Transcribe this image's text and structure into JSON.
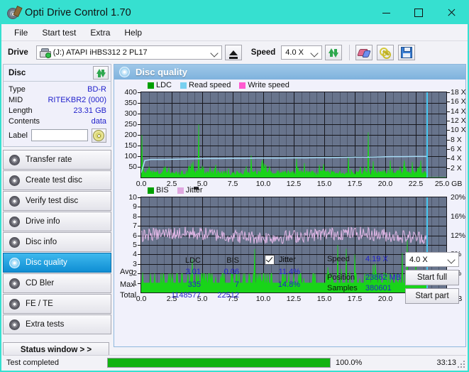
{
  "window": {
    "title": "Opti Drive Control 1.70",
    "icon": "disc-pen-icon",
    "minimize": "minimize",
    "maximize": "maximize",
    "close": "close",
    "titlebar_color": "#36e0d0"
  },
  "menubar": {
    "items": [
      {
        "label": "File"
      },
      {
        "label": "Start test"
      },
      {
        "label": "Extra"
      },
      {
        "label": "Help"
      }
    ]
  },
  "toolbar": {
    "drive_label": "Drive",
    "drive_value": "(J:)   ATAPI iHBS312   2 PL17",
    "eject_title": "eject",
    "speed_label": "Speed",
    "speed_value": "4.0 X",
    "refresh_title": "refresh",
    "erase_title": "erase",
    "tools_title": "tools",
    "save_title": "save"
  },
  "disc_panel": {
    "title": "Disc",
    "refresh_title": "refresh-disc",
    "rows": [
      {
        "key": "Type",
        "value": "BD-R"
      },
      {
        "key": "MID",
        "value": "RITEKBR2 (000)"
      },
      {
        "key": "Length",
        "value": "23.31 GB"
      },
      {
        "key": "Contents",
        "value": "data"
      }
    ],
    "label_key": "Label",
    "label_value": "",
    "label_placeholder": "",
    "cd_button_title": "disc-label"
  },
  "nav": {
    "items": [
      {
        "label": "Transfer rate",
        "active": false
      },
      {
        "label": "Create test disc",
        "active": false
      },
      {
        "label": "Verify test disc",
        "active": false
      },
      {
        "label": "Drive info",
        "active": false
      },
      {
        "label": "Disc info",
        "active": false
      },
      {
        "label": "Disc quality",
        "active": true
      },
      {
        "label": "CD Bler",
        "active": false
      },
      {
        "label": "FE / TE",
        "active": false
      },
      {
        "label": "Extra tests",
        "active": false
      }
    ],
    "status_window": "Status window > >"
  },
  "content": {
    "title": "Disc quality",
    "icon": "disc-quality-icon"
  },
  "chart_data": [
    {
      "type": "line",
      "name": "ldc-read-speed-chart",
      "title": "",
      "xlabel": "GB",
      "ylabel": "LDC",
      "xlim": [
        0,
        25.0
      ],
      "ylim": [
        0,
        400
      ],
      "y2lim": [
        0,
        18
      ],
      "y2label": "X",
      "grid": true,
      "legend_position": "top-left",
      "legend": [
        {
          "label": "LDC",
          "color": "#00a000"
        },
        {
          "label": "Read speed",
          "color": "#79d0f0"
        },
        {
          "label": "Write speed",
          "color": "#ff5ad0"
        }
      ],
      "xticks": [
        "0.0",
        "2.5",
        "5.0",
        "7.5",
        "10.0",
        "12.5",
        "15.0",
        "17.5",
        "20.0",
        "22.5",
        "25.0 GB"
      ],
      "yticks": [
        "400",
        "350",
        "300",
        "250",
        "200",
        "150",
        "100",
        "50"
      ],
      "y2ticks": [
        "18 X",
        "16 X",
        "14 X",
        "12 X",
        "10 X",
        "8 X",
        "6 X",
        "4 X",
        "2 X"
      ],
      "series": [
        {
          "name": "LDC",
          "color": "#00c000",
          "x": [
            0.05,
            0.15,
            0.3,
            0.5,
            0.7,
            0.9,
            1.1,
            1.3,
            1.5,
            1.7,
            1.9,
            2.1,
            2.3,
            2.5,
            2.7,
            2.9,
            3.1,
            3.3,
            3.5,
            3.7,
            3.9,
            4.1,
            4.25,
            4.4,
            4.55,
            4.7,
            4.85,
            5.0,
            5.15,
            5.3,
            5.45,
            5.6,
            5.8,
            6.0,
            6.2,
            6.4,
            6.6,
            6.8,
            7.0,
            7.2,
            7.4,
            7.6,
            7.8,
            8.0,
            8.2,
            8.4,
            8.6,
            8.8,
            9.0,
            9.2,
            9.4,
            9.6,
            9.8,
            10.0,
            10.2,
            10.4,
            10.6,
            10.8,
            11.0,
            11.2,
            11.4,
            11.6,
            11.8,
            12.0,
            12.2,
            12.4,
            12.6,
            12.8,
            13.0,
            13.2,
            13.4,
            13.6,
            13.8,
            14.0,
            14.2,
            14.4,
            14.6,
            14.8,
            15.0,
            15.2,
            15.4,
            15.6,
            15.8,
            16.0,
            16.2,
            16.4,
            16.6,
            16.8,
            17.0,
            17.2,
            17.4,
            17.6,
            17.8,
            18.0,
            18.2,
            18.4,
            18.6,
            18.8,
            19.0,
            19.2,
            19.4,
            19.6,
            19.8,
            20.0,
            20.2,
            20.4,
            20.6,
            20.8,
            21.0,
            21.2,
            21.4,
            21.6,
            21.8,
            22.0,
            22.2,
            22.4,
            22.6,
            22.8,
            23.0,
            23.2,
            23.4
          ],
          "values": [
            260,
            30,
            25,
            20,
            40,
            22,
            18,
            30,
            20,
            25,
            35,
            20,
            18,
            25,
            30,
            20,
            25,
            18,
            22,
            30,
            60,
            325,
            90,
            40,
            60,
            340,
            110,
            45,
            30,
            35,
            50,
            25,
            20,
            35,
            40,
            25,
            20,
            30,
            20,
            25,
            20,
            30,
            25,
            35,
            20,
            25,
            30,
            20,
            155,
            40,
            25,
            35,
            60,
            25,
            20,
            30,
            25,
            20,
            30,
            35,
            25,
            20,
            30,
            25,
            20,
            35,
            25,
            20,
            30,
            25,
            20,
            30,
            20,
            25,
            30,
            20,
            25,
            35,
            20,
            25,
            30,
            20,
            25,
            30,
            25,
            20,
            30,
            25,
            285,
            55,
            30,
            40,
            25,
            35,
            30,
            25,
            245,
            30,
            115,
            60,
            25,
            35,
            80,
            25,
            30,
            100,
            50,
            30,
            40,
            25,
            30,
            45,
            25,
            30,
            100,
            40,
            30,
            70,
            25,
            30,
            25
          ]
        },
        {
          "name": "Read speed",
          "color": "#9fd8f4",
          "x": [
            0.0,
            0.3,
            0.8,
            1.5,
            2.5,
            3.5,
            4.5,
            5.5,
            6.5,
            7.5,
            8.5,
            9.5,
            10.5,
            11.5,
            12.5,
            13.5,
            14.5,
            15.5,
            16.5,
            17.5,
            18.5,
            19.5,
            20.5,
            21.5,
            22.5,
            23.4
          ],
          "values": [
            1.0,
            3.6,
            3.8,
            3.8,
            3.85,
            3.9,
            3.95,
            4.0,
            4.0,
            4.05,
            4.05,
            4.1,
            4.1,
            4.1,
            4.15,
            4.15,
            4.2,
            4.2,
            4.25,
            4.3,
            4.3,
            4.35,
            4.4,
            4.4,
            4.45,
            4.45
          ],
          "axis": "right"
        },
        {
          "name": "Write speed",
          "color": "#ff5ad0",
          "x": [],
          "values": []
        }
      ],
      "marker_line": {
        "x": 23.4,
        "color": "#49c8f0"
      }
    },
    {
      "type": "line",
      "name": "bis-jitter-chart",
      "title": "",
      "xlabel": "GB",
      "ylabel": "BIS",
      "xlim": [
        0,
        25.0
      ],
      "ylim": [
        0,
        10
      ],
      "y2lim": [
        0,
        20
      ],
      "y2label": "%",
      "grid": true,
      "legend_position": "top-left",
      "legend": [
        {
          "label": "BIS",
          "color": "#00a000"
        },
        {
          "label": "Jitter",
          "color": "#e0a8e0"
        }
      ],
      "xticks": [
        "0.0",
        "2.5",
        "5.0",
        "7.5",
        "10.0",
        "12.5",
        "15.0",
        "17.5",
        "20.0",
        "22.5",
        "25.0 GB"
      ],
      "yticks": [
        "10",
        "9",
        "8",
        "7",
        "6",
        "5",
        "4",
        "3",
        "2",
        "1"
      ],
      "y2ticks": [
        "20%",
        "16%",
        "12%",
        "8%",
        "4%"
      ],
      "series": [
        {
          "name": "BIS",
          "color": "#00c000",
          "baseline": 1,
          "spikes_x": [
            0.1,
            0.45,
            0.8,
            1.2,
            1.6,
            1.85,
            2.2,
            2.6,
            3.0,
            3.4,
            3.8,
            4.05,
            4.2,
            4.45,
            4.6,
            4.9,
            5.3,
            5.7,
            6.1,
            6.5,
            6.9,
            7.3,
            7.7,
            8.1,
            8.5,
            8.9,
            9.3,
            9.6,
            9.9,
            10.2,
            10.5,
            10.9,
            11.3,
            11.7,
            12.1,
            12.5,
            12.9,
            13.3,
            13.7,
            14.1,
            14.5,
            14.9,
            15.3,
            15.7,
            16.1,
            16.4,
            16.8,
            17.1,
            17.5,
            17.9,
            18.3,
            18.7,
            19.0,
            19.2,
            19.5,
            19.9,
            20.3,
            20.6,
            21.0,
            21.4,
            21.8,
            22.1,
            22.5,
            22.9,
            23.2
          ],
          "spikes_y": [
            5,
            2,
            2,
            3,
            2,
            3,
            2,
            2,
            2,
            3,
            5,
            3,
            7,
            3,
            2,
            2,
            2,
            2,
            2,
            3,
            2,
            2,
            3,
            2,
            3,
            2,
            5,
            2,
            3,
            4,
            2,
            2,
            2,
            3,
            2,
            2,
            2,
            3,
            4,
            2,
            3,
            2,
            4,
            2,
            6,
            3,
            5,
            3,
            4,
            2,
            4,
            7,
            5,
            6,
            3,
            5,
            3,
            4,
            2,
            5,
            6,
            3,
            4,
            3,
            2
          ]
        },
        {
          "name": "Jitter",
          "color": "#e0b4e0",
          "mean": 6.0,
          "amplitude": 0.7,
          "axis": "right",
          "mean_percent": 11.4
        }
      ],
      "marker_line": {
        "x": 23.4,
        "color": "#49c8f0"
      }
    }
  ],
  "stats": {
    "columns": [
      "LDC",
      "BIS"
    ],
    "jitter_label": "Jitter",
    "jitter_checked": true,
    "rows": [
      {
        "key": "Avg",
        "ldc": "3.01",
        "bis": "0.06",
        "jitter": "11.4%"
      },
      {
        "key": "Max",
        "ldc": "335",
        "bis": "7",
        "jitter": "14.8%"
      },
      {
        "key": "Total",
        "ldc": "1148577",
        "bis": "22512",
        "jitter": ""
      }
    ],
    "speed_key": "Speed",
    "speed_value": "4.19 X",
    "position_key": "Position",
    "position_value": "23862 MB",
    "samples_key": "Samples",
    "samples_value": "380601",
    "speed_select": "4.0 X",
    "start_full": "Start full",
    "start_part": "Start part"
  },
  "statusbar": {
    "text": "Test completed",
    "percent": "100.0%",
    "progress": 100,
    "time": "33:13",
    "progress_color": "#12b312"
  }
}
